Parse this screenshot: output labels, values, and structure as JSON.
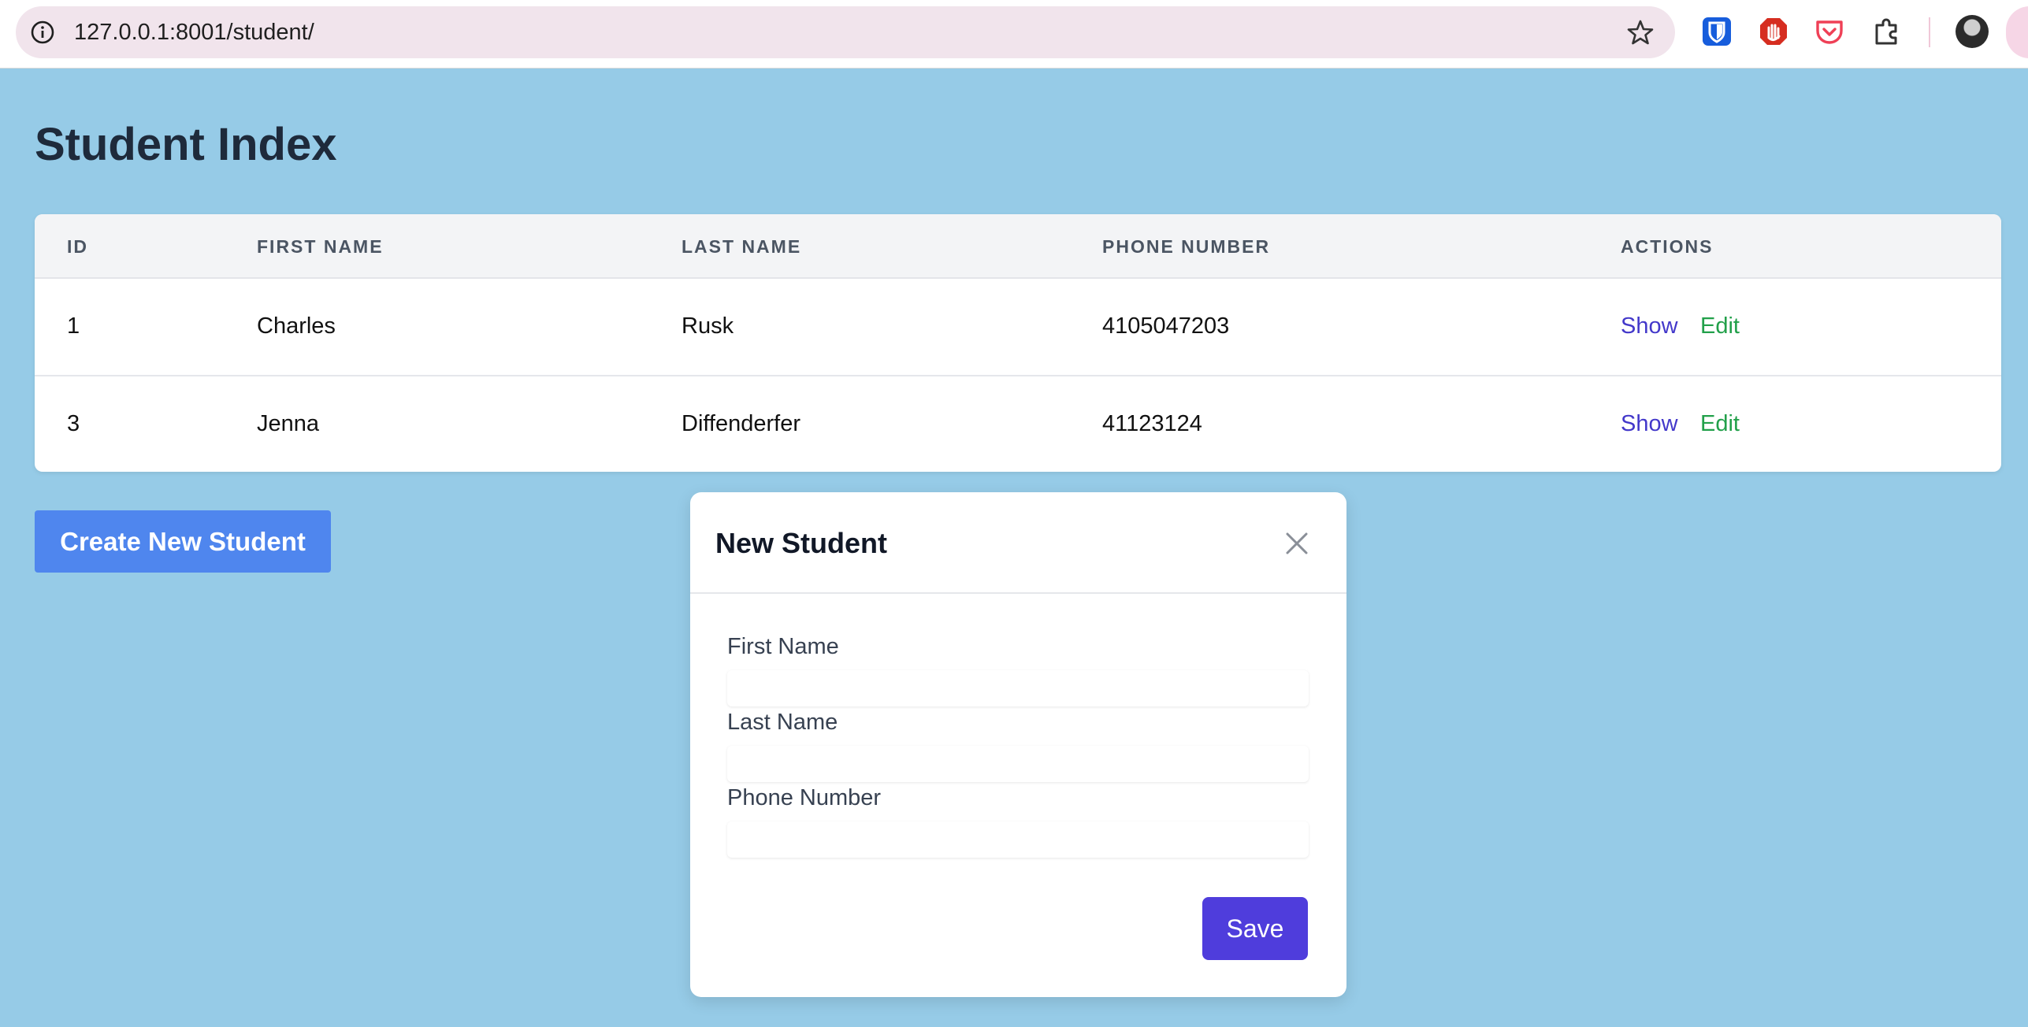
{
  "browser": {
    "url": "127.0.0.1:8001/student/",
    "icons": [
      "site-info-icon",
      "bookmark-star-icon",
      "bitwarden-icon",
      "ublock-icon",
      "pocket-icon",
      "extensions-puzzle-icon",
      "profile-avatar"
    ],
    "colors": {
      "omnibox_bg": "#f1e4ec",
      "bitwarden": "#175ddc",
      "ublock": "#d62d20",
      "pocket": "#ef4056"
    }
  },
  "page": {
    "title": "Student Index",
    "background": "#96cbe7"
  },
  "table": {
    "headers": [
      "ID",
      "FIRST NAME",
      "LAST NAME",
      "PHONE NUMBER",
      "ACTIONS"
    ],
    "rows": [
      {
        "id": "1",
        "first_name": "Charles",
        "last_name": "Rusk",
        "phone": "4105047203",
        "show": "Show",
        "edit": "Edit"
      },
      {
        "id": "3",
        "first_name": "Jenna",
        "last_name": "Diffenderfer",
        "phone": "41123124",
        "show": "Show",
        "edit": "Edit"
      }
    ],
    "colors": {
      "show_link": "#4338ca",
      "edit_link": "#22a04a"
    }
  },
  "actions": {
    "create_label": "Create New Student",
    "create_color": "#4f86ee"
  },
  "modal": {
    "title": "New Student",
    "fields": [
      {
        "label": "First Name",
        "value": ""
      },
      {
        "label": "Last Name",
        "value": ""
      },
      {
        "label": "Phone Number",
        "value": ""
      }
    ],
    "save_label": "Save",
    "save_color": "#4f3ddc"
  }
}
